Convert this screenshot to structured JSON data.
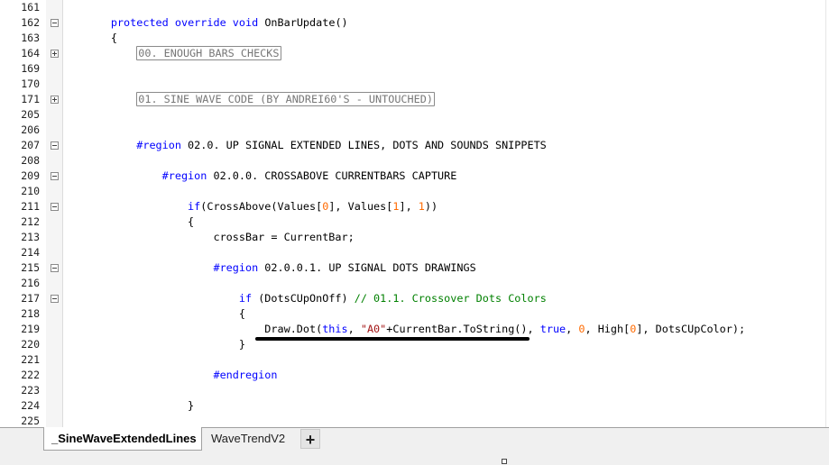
{
  "editor": {
    "lines": [
      {
        "num": "161",
        "indent": "",
        "fold": "",
        "tokens": []
      },
      {
        "num": "162",
        "indent": "        ",
        "fold": "minus",
        "tokens": [
          {
            "t": "protected",
            "c": "kw"
          },
          {
            "t": " "
          },
          {
            "t": "override",
            "c": "kw"
          },
          {
            "t": " "
          },
          {
            "t": "void",
            "c": "kw"
          },
          {
            "t": " OnBarUpdate()"
          }
        ]
      },
      {
        "num": "163",
        "indent": "        ",
        "fold": "",
        "tokens": [
          {
            "t": "{"
          }
        ]
      },
      {
        "num": "164",
        "indent": "            ",
        "fold": "plus",
        "tokens": [
          {
            "t": "00. ENOUGH BARS CHECKS",
            "c": "collapsed"
          }
        ]
      },
      {
        "num": "169",
        "indent": "",
        "fold": "",
        "tokens": []
      },
      {
        "num": "170",
        "indent": "",
        "fold": "",
        "tokens": []
      },
      {
        "num": "171",
        "indent": "            ",
        "fold": "plus",
        "tokens": [
          {
            "t": "01. SINE WAVE CODE (BY ANDREI60'S - UNTOUCHED)",
            "c": "collapsed"
          }
        ]
      },
      {
        "num": "205",
        "indent": "",
        "fold": "",
        "tokens": []
      },
      {
        "num": "206",
        "indent": "",
        "fold": "",
        "tokens": []
      },
      {
        "num": "207",
        "indent": "            ",
        "fold": "minus",
        "tokens": [
          {
            "t": "#region",
            "c": "rg"
          },
          {
            "t": " 02.0. UP SIGNAL EXTENDED LINES, DOTS AND SOUNDS SNIPPETS"
          }
        ]
      },
      {
        "num": "208",
        "indent": "",
        "fold": "",
        "tokens": []
      },
      {
        "num": "209",
        "indent": "                ",
        "fold": "minus",
        "tokens": [
          {
            "t": "#region",
            "c": "rg"
          },
          {
            "t": " 02.0.0. CROSSABOVE CURRENTBARS CAPTURE"
          }
        ]
      },
      {
        "num": "210",
        "indent": "",
        "fold": "",
        "tokens": []
      },
      {
        "num": "211",
        "indent": "                    ",
        "fold": "minus",
        "tokens": [
          {
            "t": "if",
            "c": "kw"
          },
          {
            "t": "(CrossAbove(Values["
          },
          {
            "t": "0",
            "c": "num"
          },
          {
            "t": "], Values["
          },
          {
            "t": "1",
            "c": "num"
          },
          {
            "t": "], "
          },
          {
            "t": "1",
            "c": "num"
          },
          {
            "t": "))"
          }
        ]
      },
      {
        "num": "212",
        "indent": "                    ",
        "fold": "",
        "tokens": [
          {
            "t": "{"
          }
        ]
      },
      {
        "num": "213",
        "indent": "                        ",
        "fold": "",
        "tokens": [
          {
            "t": "crossBar = CurrentBar;"
          }
        ]
      },
      {
        "num": "214",
        "indent": "",
        "fold": "",
        "tokens": []
      },
      {
        "num": "215",
        "indent": "                        ",
        "fold": "minus",
        "tokens": [
          {
            "t": "#region",
            "c": "rg"
          },
          {
            "t": " 02.0.0.1. UP SIGNAL DOTS DRAWINGS"
          }
        ]
      },
      {
        "num": "216",
        "indent": "",
        "fold": "",
        "tokens": []
      },
      {
        "num": "217",
        "indent": "                            ",
        "fold": "minus",
        "tokens": [
          {
            "t": "if",
            "c": "kw"
          },
          {
            "t": " (DotsCUpOnOff) "
          },
          {
            "t": "// 01.1. Crossover Dots Colors",
            "c": "cm"
          }
        ]
      },
      {
        "num": "218",
        "indent": "                            ",
        "fold": "",
        "tokens": [
          {
            "t": "{"
          }
        ]
      },
      {
        "num": "219",
        "indent": "                                ",
        "fold": "",
        "tokens": [
          {
            "t": "Draw.Dot("
          },
          {
            "t": "this",
            "c": "kw"
          },
          {
            "t": ", "
          },
          {
            "t": "\"A0\"",
            "c": "str"
          },
          {
            "t": "+CurrentBar.ToString(), "
          },
          {
            "t": "true",
            "c": "kw"
          },
          {
            "t": ", "
          },
          {
            "t": "0",
            "c": "num"
          },
          {
            "t": ", High["
          },
          {
            "t": "0",
            "c": "num"
          },
          {
            "t": "], DotsCUpColor);"
          }
        ]
      },
      {
        "num": "220",
        "indent": "                            ",
        "fold": "",
        "tokens": [
          {
            "t": "}"
          }
        ]
      },
      {
        "num": "221",
        "indent": "",
        "fold": "",
        "tokens": []
      },
      {
        "num": "222",
        "indent": "                        ",
        "fold": "",
        "tokens": [
          {
            "t": "#endregion",
            "c": "rg"
          }
        ]
      },
      {
        "num": "223",
        "indent": "",
        "fold": "",
        "tokens": []
      },
      {
        "num": "224",
        "indent": "                    ",
        "fold": "",
        "tokens": [
          {
            "t": "}"
          }
        ]
      },
      {
        "num": "225",
        "indent": "",
        "fold": "",
        "tokens": []
      }
    ]
  },
  "tabs": {
    "items": [
      {
        "label": "_SineWaveExtendedLines",
        "active": true
      },
      {
        "label": "WaveTrendV2",
        "active": false
      }
    ],
    "add_label": "+"
  }
}
